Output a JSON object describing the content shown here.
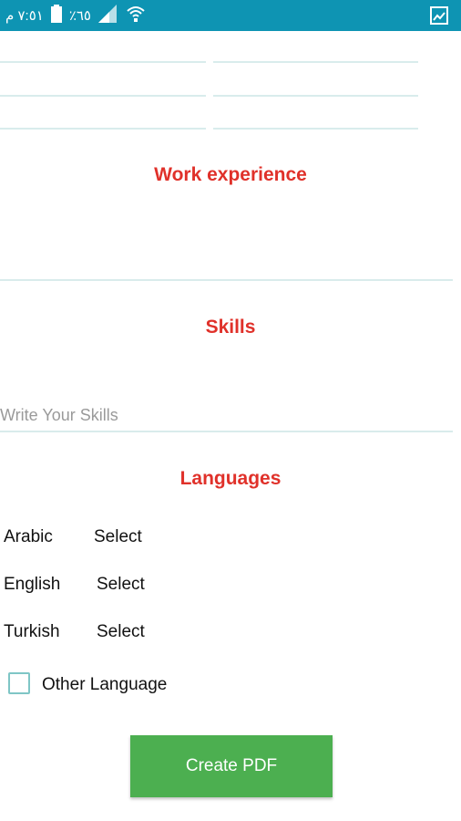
{
  "status_bar": {
    "time": "٧:٥١ م",
    "battery": "٪٦٥",
    "background_color": "#0e94b3",
    "icons": [
      "battery-icon",
      "signal-icon",
      "wifi-icon",
      "gallery-notification-icon"
    ]
  },
  "sections": {
    "work_experience_title": "Work experience",
    "skills_title": "Skills",
    "languages_title": "Languages"
  },
  "skills": {
    "placeholder": "Write Your Skills",
    "value": ""
  },
  "languages": [
    {
      "name": "Arabic",
      "level": "Select"
    },
    {
      "name": "English",
      "level": "Select"
    },
    {
      "name": "Turkish",
      "level": "Select"
    }
  ],
  "other_language": {
    "label": "Other Language",
    "checked": false
  },
  "create_pdf": {
    "label": "Create PDF",
    "color": "#4caf50"
  },
  "title_color": "#e0312a"
}
